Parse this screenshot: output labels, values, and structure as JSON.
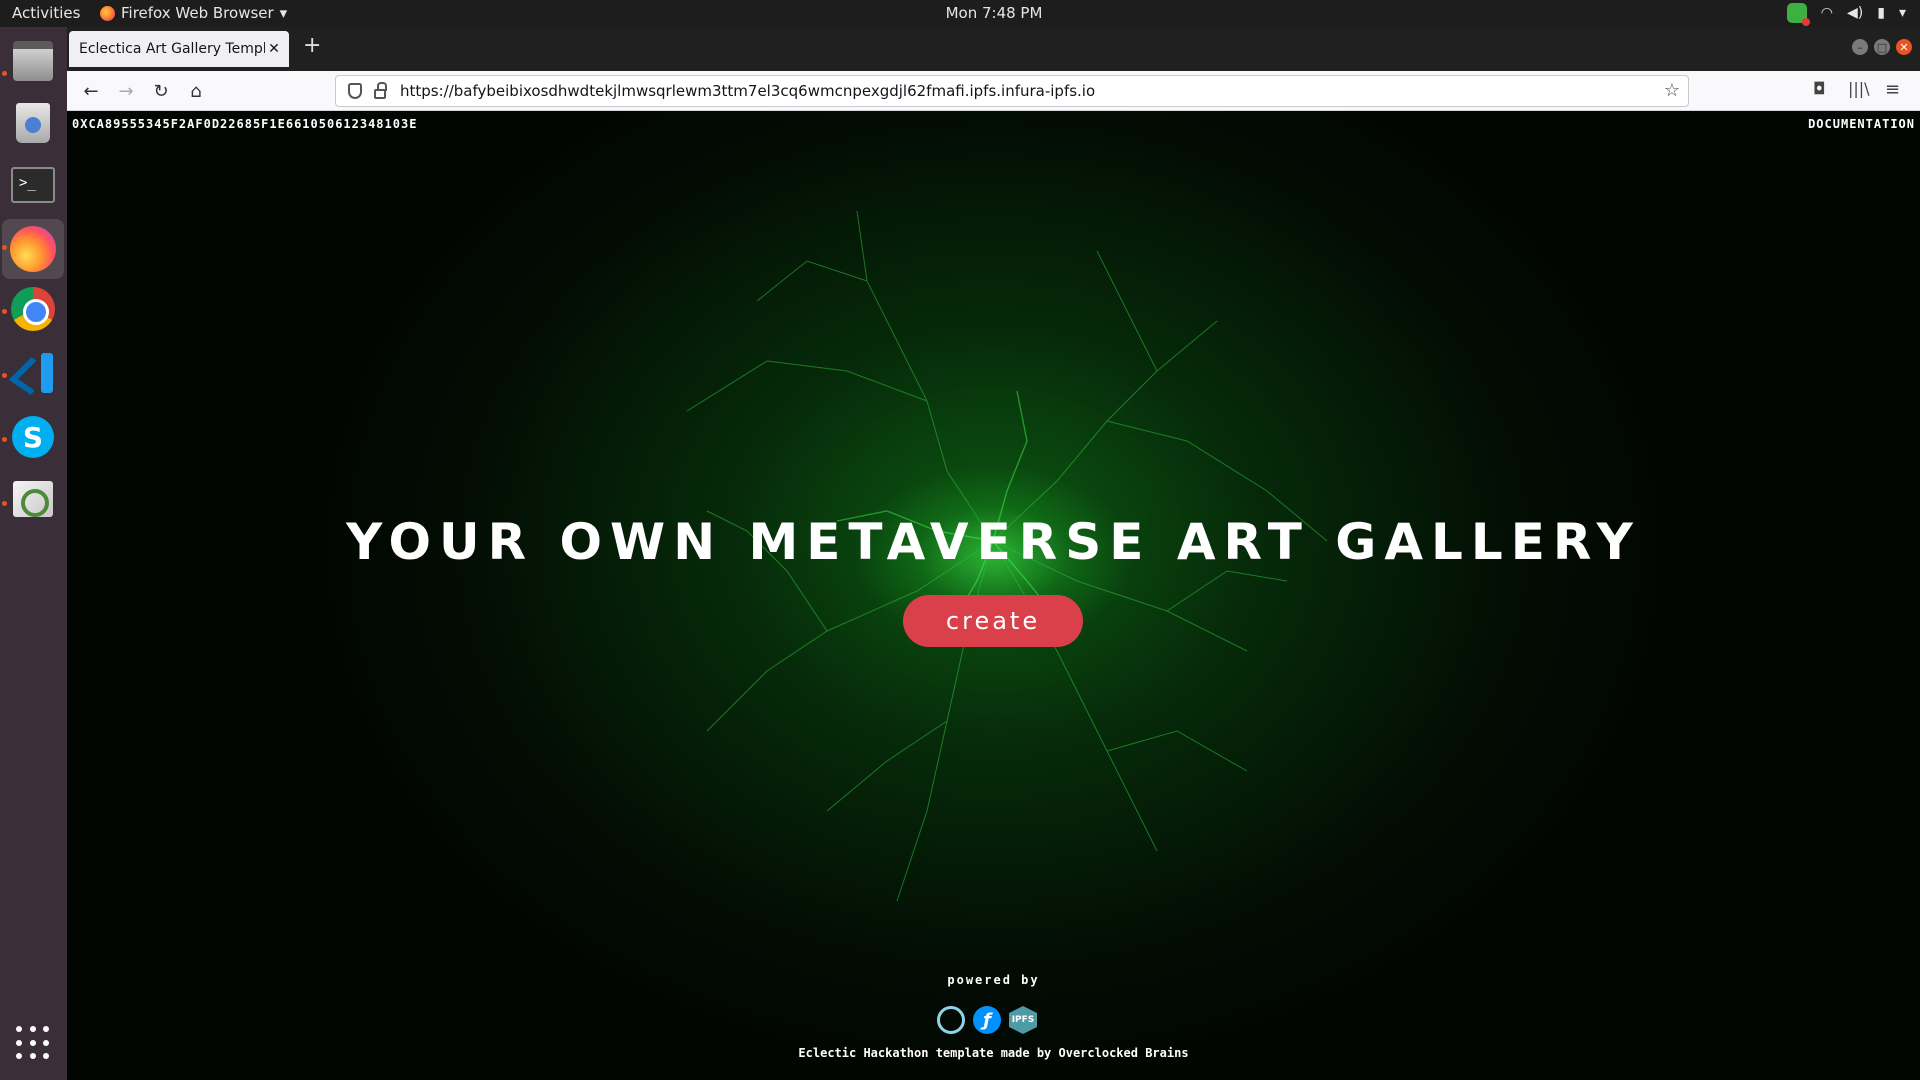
{
  "system": {
    "activities": "Activities",
    "app_menu": "Firefox Web Browser",
    "clock": "Mon  7:48 PM"
  },
  "browser": {
    "tab_title": "Eclectica Art Gallery Templat",
    "url": "https://bafybeibixosdhwdtekjlmwsqrlewm3ttm7el3cq6wmcnpexgdjl62fmafi.ipfs.infura-ipfs.io"
  },
  "page": {
    "wallet_address": "0xca89555345f2af0d22685f1e661050612348103e",
    "documentation_link": "documentation",
    "hero_title": "YOUR OWN METAVERSE ART GALLERY",
    "create_button": "create",
    "powered_by": "powered by",
    "logos": [
      "Lit Protocol",
      "Filecoin",
      "IPFS"
    ],
    "ipfs_text": "IPFS",
    "credit": "Eclectic Hackathon template made by Overclocked Brains"
  },
  "colors": {
    "accent_button": "#d9404a",
    "background": "#020602",
    "glow": "#3cff46"
  }
}
